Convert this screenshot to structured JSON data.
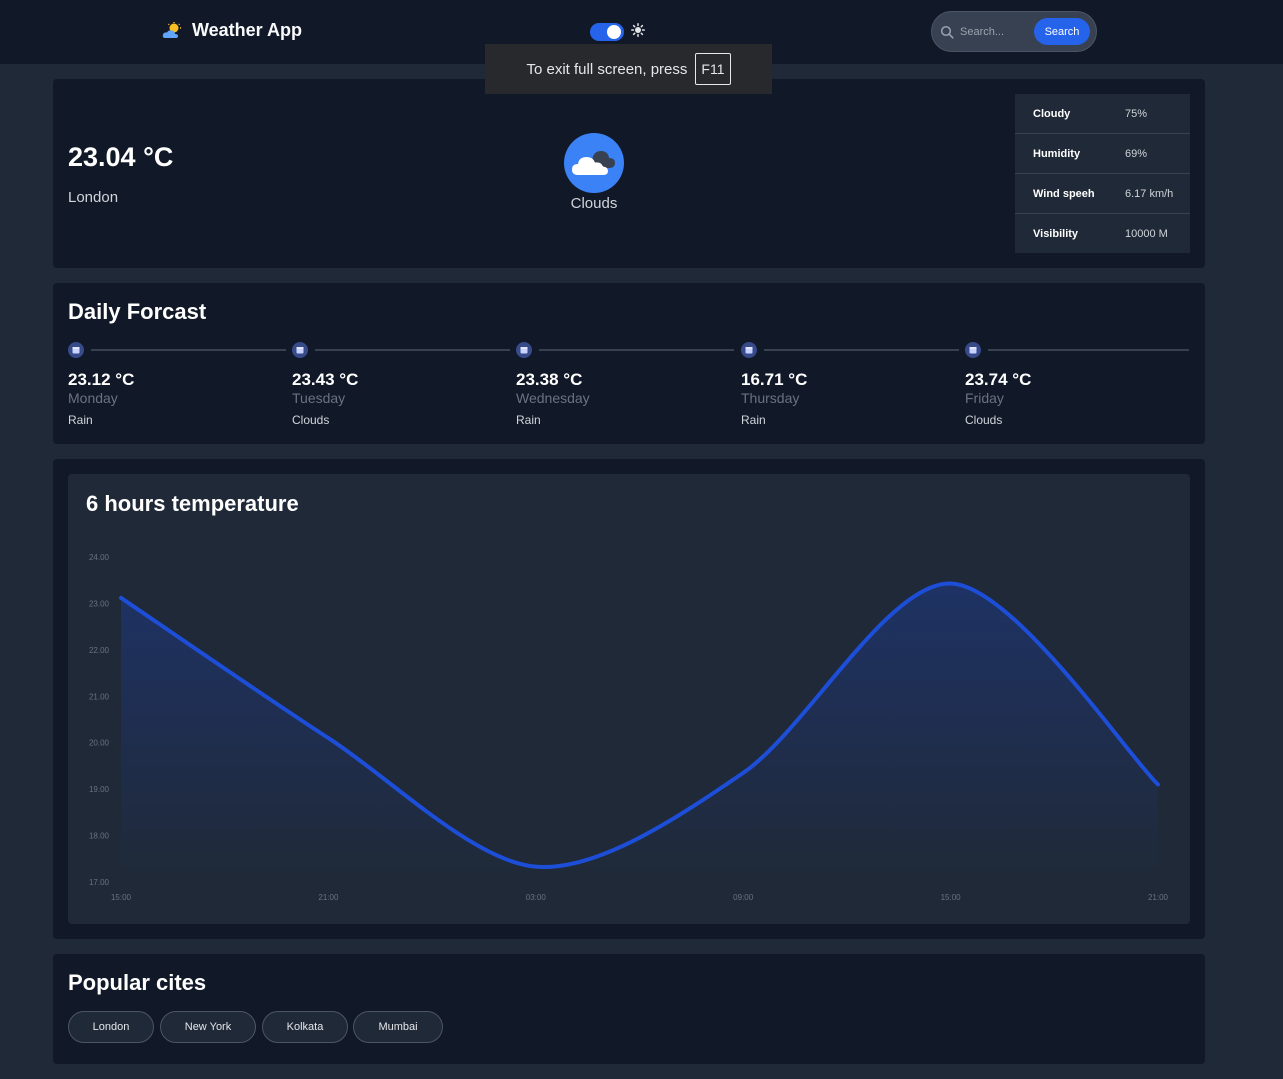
{
  "header": {
    "title": "Weather App",
    "theme_toggle_on": true,
    "search_placeholder": "Search...",
    "search_button": "Search"
  },
  "fullscreen_notice": {
    "text": "To exit full screen, press",
    "key": "F11"
  },
  "current": {
    "temperature": "23.04 °C",
    "city": "London",
    "condition": "Clouds",
    "condition_icon": "cloud-icon",
    "stats": [
      {
        "label": "Cloudy",
        "value": "75%"
      },
      {
        "label": "Humidity",
        "value": "69%"
      },
      {
        "label": "Wind speeh",
        "value": "6.17 km/h"
      },
      {
        "label": "Visibility",
        "value": "10000 M"
      }
    ]
  },
  "daily": {
    "title": "Daily Forcast",
    "days": [
      {
        "temp": "23.12 °C",
        "day": "Monday",
        "cond": "Rain"
      },
      {
        "temp": "23.43 °C",
        "day": "Tuesday",
        "cond": "Clouds"
      },
      {
        "temp": "23.38 °C",
        "day": "Wednesday",
        "cond": "Rain"
      },
      {
        "temp": "16.71 °C",
        "day": "Thursday",
        "cond": "Rain"
      },
      {
        "temp": "23.74 °C",
        "day": "Friday",
        "cond": "Clouds"
      }
    ]
  },
  "chart_data": {
    "type": "area",
    "title": "6 hours temperature",
    "xlabel": "",
    "ylabel": "",
    "x": [
      "15:00",
      "21:00",
      "03:00",
      "09:00",
      "15:00",
      "21:00"
    ],
    "series": [
      {
        "values": [
          23.12,
          20.1,
          17.33,
          19.35,
          23.43,
          19.1
        ]
      }
    ],
    "ylim": [
      17,
      24
    ],
    "yticks": [
      "17.00",
      "18.00",
      "19.00",
      "20.00",
      "21.00",
      "22.00",
      "23.00",
      "24.00"
    ],
    "grid": false,
    "line_color": "#1d4ed8",
    "fill_color": "#1e3a8a"
  },
  "popular": {
    "title": "Popular cites",
    "cities": [
      "London",
      "New York",
      "Kolkata",
      "Mumbai"
    ]
  },
  "colors": {
    "accent": "#2563eb",
    "background": "#1f2937",
    "card": "#111827"
  }
}
